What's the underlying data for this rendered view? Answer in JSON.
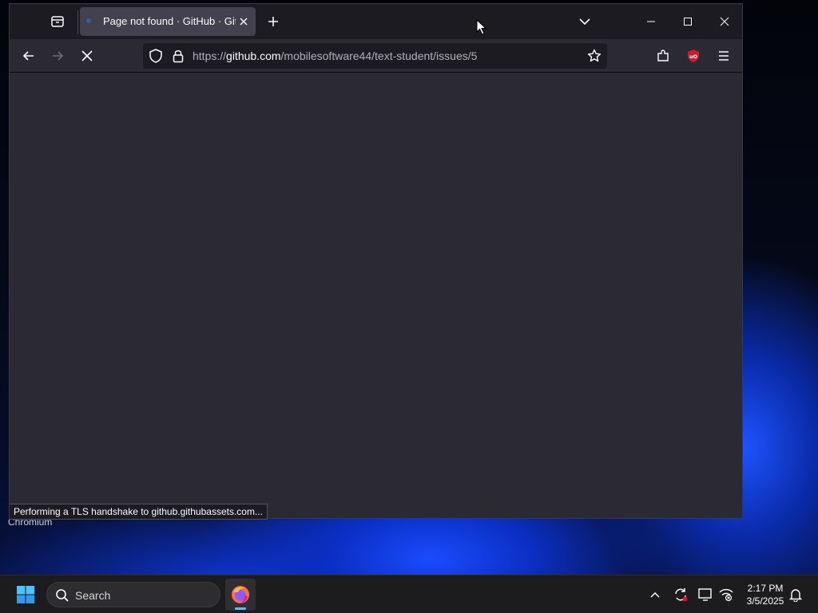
{
  "desktop": {
    "labels": [
      "Chromium"
    ]
  },
  "browser": {
    "tab": {
      "title": "Page not found · GitHub · GitHub"
    },
    "url": {
      "scheme": "https://",
      "host": "github.com",
      "path": "/mobilesoftware44/text-student/issues/5"
    },
    "status_text": "Performing a TLS handshake to github.githubassets.com..."
  },
  "taskbar": {
    "search_label": "Search",
    "clock": {
      "time": "2:17 PM",
      "date": "3/5/2025"
    }
  },
  "colors": {
    "browser_bg": "#2b2a33",
    "tabbar_bg": "#1c1b22",
    "active_tab": "#42414d",
    "ublock_red": "#d21c2d",
    "firefox_orange": "#ff7139"
  },
  "icons": [
    "tab-list-icon",
    "close-icon",
    "plus-icon",
    "chevron-down-icon",
    "minimize-icon",
    "maximize-icon",
    "back-icon",
    "forward-icon",
    "stop-icon",
    "shield-icon",
    "lock-icon",
    "star-icon",
    "extensions-icon",
    "ublock-icon",
    "menu-icon",
    "windows-start-icon",
    "search-icon",
    "firefox-icon",
    "chevron-up-icon",
    "sync-icon",
    "display-icon",
    "network-icon",
    "bell-icon"
  ]
}
